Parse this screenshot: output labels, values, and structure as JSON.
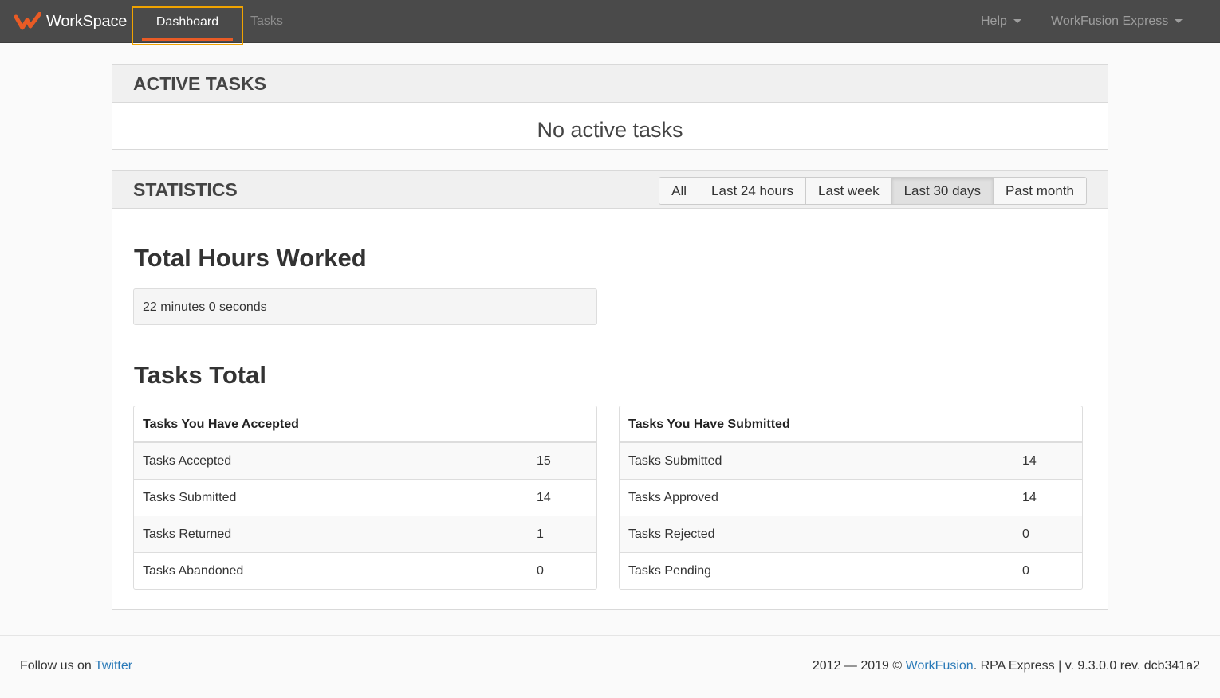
{
  "navbar": {
    "brand": "WorkSpace",
    "active_tab": "Dashboard",
    "tasks_tab": "Tasks",
    "help_menu": "Help",
    "user_menu": "WorkFusion Express"
  },
  "active_tasks": {
    "title": "ACTIVE TASKS",
    "empty_message": "No active tasks"
  },
  "statistics": {
    "title": "STATISTICS",
    "filters": [
      "All",
      "Last 24 hours",
      "Last week",
      "Last 30 days",
      "Past month"
    ],
    "active_filter": "Last 30 days",
    "hours_heading": "Total Hours Worked",
    "hours_value": "22 minutes 0 seconds",
    "tasks_heading": "Tasks Total",
    "accepted_table": {
      "header": "Tasks You Have Accepted",
      "rows": [
        {
          "label": "Tasks Accepted",
          "value": "15"
        },
        {
          "label": "Tasks Submitted",
          "value": "14"
        },
        {
          "label": "Tasks Returned",
          "value": "1"
        },
        {
          "label": "Tasks Abandoned",
          "value": "0"
        }
      ]
    },
    "submitted_table": {
      "header": "Tasks You Have Submitted",
      "rows": [
        {
          "label": "Tasks Submitted",
          "value": "14"
        },
        {
          "label": "Tasks Approved",
          "value": "14"
        },
        {
          "label": "Tasks Rejected",
          "value": "0"
        },
        {
          "label": "Tasks Pending",
          "value": "0"
        }
      ]
    }
  },
  "footer": {
    "follow_text": "Follow us on",
    "twitter_link": "Twitter",
    "copyright_prefix": "2012 — 2019 ©",
    "company_link": "WorkFusion",
    "version_text": ". RPA Express | v. 9.3.0.0 rev. dcb341a2"
  },
  "colors": {
    "navbar_bg": "#4a4a4a",
    "accent_orange": "#e95b25",
    "highlight_border": "#f0a300",
    "link": "#2a7ab8"
  },
  "icons": {
    "brand_logo": "workfusion-logo-icon",
    "menu_caret": "caret-down-icon"
  }
}
